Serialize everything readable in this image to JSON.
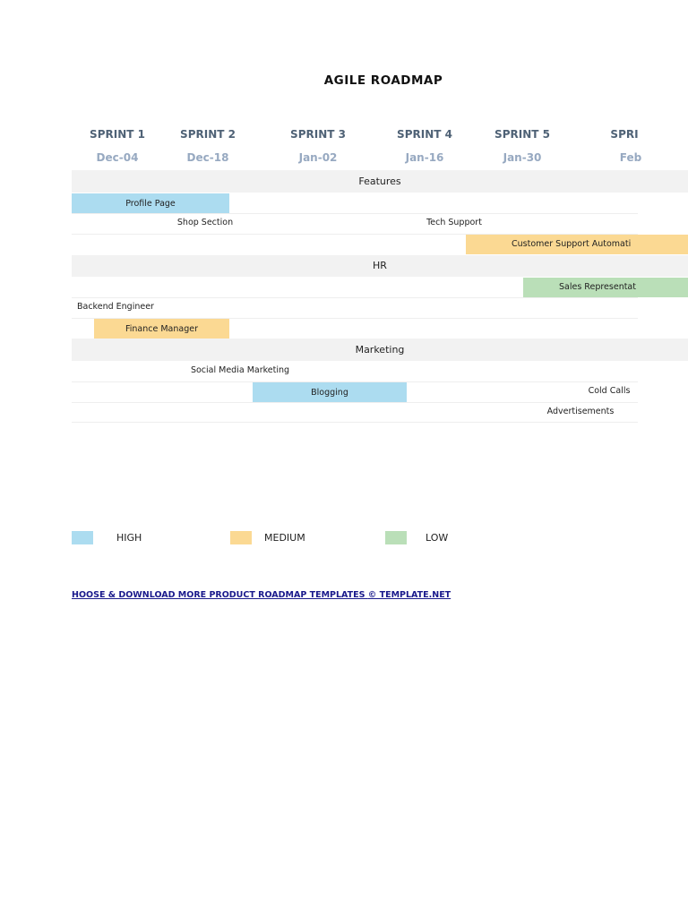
{
  "title": "AGILE ROADMAP",
  "sprints": [
    {
      "label": "SPRINT 1",
      "date": "Dec-04"
    },
    {
      "label": "SPRINT 2",
      "date": "Dec-18"
    },
    {
      "label": "SPRINT 3",
      "date": "Jan-02"
    },
    {
      "label": "SPRINT 4",
      "date": "Jan-16"
    },
    {
      "label": "SPRINT 5",
      "date": "Jan-30"
    },
    {
      "label": "SPRI",
      "date": "Feb"
    }
  ],
  "sections": {
    "features": {
      "label": "Features",
      "items": [
        "Profile Page",
        "Shop Section",
        "Tech Support",
        "Customer Support Automati"
      ]
    },
    "hr": {
      "label": "HR",
      "items": [
        "Sales Representat",
        "Backend Engineer",
        "Finance Manager"
      ]
    },
    "marketing": {
      "label": "Marketing",
      "items": [
        "Social Media Marketing",
        "Blogging",
        "Cold Calls",
        "Advertisements"
      ]
    }
  },
  "legend": [
    {
      "label": "HIGH",
      "color": "#acdcf0"
    },
    {
      "label": "MEDIUM",
      "color": "#fbd993"
    },
    {
      "label": "LOW",
      "color": "#badfb8"
    }
  ],
  "footer": {
    "link": "HOOSE & DOWNLOAD MORE PRODUCT ROADMAP TEMPLATES",
    "copyright": "©  TEMPLATE.NET"
  }
}
